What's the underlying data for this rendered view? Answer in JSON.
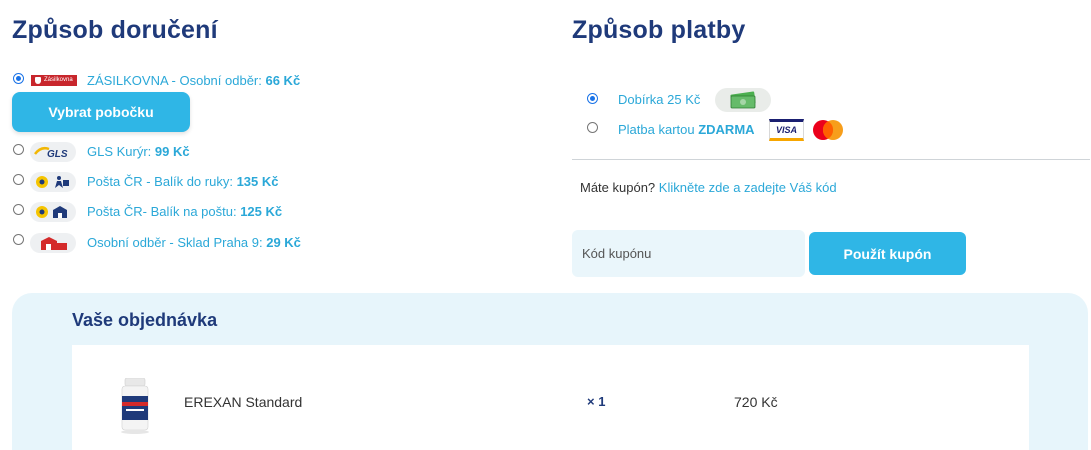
{
  "delivery": {
    "heading": "Způsob doručení",
    "pickup_button": "Vybrat pobočku",
    "options": [
      {
        "label": "ZÁSILKOVNA - Osobní odběr: ",
        "price": "66 Kč",
        "selected": true,
        "logo": "zasilkovna-logo",
        "logo_text": "Zásilkovna"
      },
      {
        "label": "GLS Kurýr: ",
        "price": "99 Kč",
        "selected": false,
        "logo": "gls-logo",
        "logo_text": "GLS"
      },
      {
        "label": "Pošta ČR - Balík do ruky: ",
        "price": "135 Kč",
        "selected": false,
        "logo": "posta-courier-logo"
      },
      {
        "label": "Pošta ČR- Balík na poštu: ",
        "price": "125 Kč",
        "selected": false,
        "logo": "posta-office-logo"
      },
      {
        "label": "Osobní odběr - Sklad Praha 9: ",
        "price": "29 Kč",
        "selected": false,
        "logo": "warehouse-logo"
      }
    ]
  },
  "payment": {
    "heading": "Způsob platby",
    "options": [
      {
        "label": "Dobírka 25 Kč",
        "selected": true,
        "icon": "cash-icon"
      },
      {
        "label": "Platba kartou ",
        "label_bold": "ZDARMA",
        "selected": false,
        "icons": [
          "visa-logo",
          "mastercard-logo"
        ],
        "visa_text": "VISA"
      }
    ]
  },
  "coupon": {
    "question": "Máte kupón? ",
    "link": "Klikněte zde a zadejte Váš kód",
    "placeholder": "Kód kupónu",
    "apply_button": "Použít kupón"
  },
  "order": {
    "title": "Vaše objednávka",
    "items": [
      {
        "name": "EREXAN Standard",
        "qty": "× 1",
        "price": "720 Kč",
        "image": "erexan-bottle-image"
      }
    ]
  },
  "colors": {
    "accent": "#2fb6e6",
    "heading": "#1f3a7a",
    "link": "#2ba8d8",
    "panel": "#e7f5fb"
  }
}
